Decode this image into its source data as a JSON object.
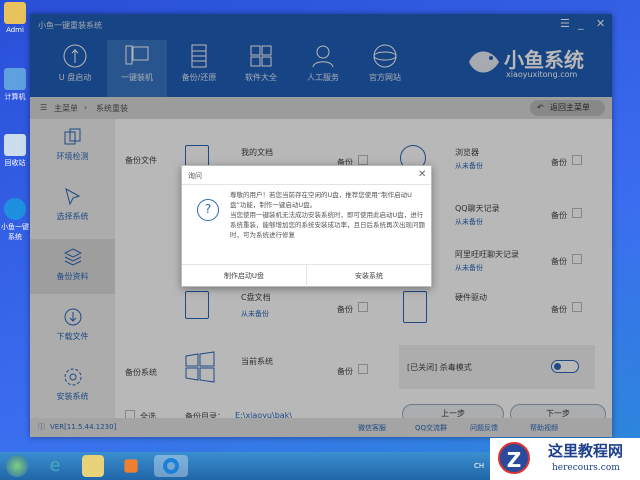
{
  "desktop": {
    "icons": [
      {
        "label": "Admi"
      },
      {
        "label": "计算机"
      },
      {
        "label": "回收站"
      },
      {
        "label": "小鱼一键系统"
      }
    ]
  },
  "window": {
    "title": "小鱼一键重装系统",
    "menu_icon": "menu-icon",
    "min_icon": "minimize-icon",
    "close_icon": "close-icon"
  },
  "nav": [
    {
      "label": "U 盘启动"
    },
    {
      "label": "一键装机",
      "active": true
    },
    {
      "label": "备份/还原"
    },
    {
      "label": "软件大全"
    },
    {
      "label": "人工服务"
    },
    {
      "label": "官方网站"
    }
  ],
  "logo": {
    "name": "小鱼系统",
    "url": "xiaoyuxitong.com"
  },
  "breadcrumb": {
    "home": "主菜单",
    "current": "系统重装",
    "back": "返回主菜单"
  },
  "sidebar": [
    {
      "label": "环境检测"
    },
    {
      "label": "选择系统"
    },
    {
      "label": "备份资料",
      "active": true
    },
    {
      "label": "下载文件"
    },
    {
      "label": "安装系统"
    }
  ],
  "backup": {
    "files_label": "备份文件",
    "system_label": "备份系统",
    "backup_word": "备份",
    "never": "从未备份",
    "items": [
      {
        "name": "我的文档"
      },
      {
        "name": "浏览器"
      },
      {
        "name": "QQ聊天记录"
      },
      {
        "name": "阿里旺旺聊天记录"
      },
      {
        "name": "C盘文档"
      },
      {
        "name": "硬件驱动"
      },
      {
        "name": "当前系统"
      }
    ],
    "antivirus": "[已关闭] 杀毒模式",
    "antivirus_on": false,
    "select_all": "全选",
    "dir_label": "备份目录：",
    "dir": "E:\\xiaoyu\\bak\\",
    "prev": "上一步",
    "next": "下一步"
  },
  "footer": {
    "version": "VER[11.5.44.1230]",
    "links": [
      "微信客服",
      "QQ交流群",
      "问题反馈",
      "帮助视频"
    ]
  },
  "dialog": {
    "title": "询问",
    "message1": "尊敬的用户！若您当前存在空闲的U盘，推荐您使用“制作启动U盘”功能，制作一键启动U盘。",
    "message2": "当您使用一键装机无法成功安装系统时，即可使用此启动U盘，进行系统重装，能够增加您的系统安装成功率，且日后系统再次出现问题时，可为系统进行修复",
    "btn_usb": "制作启动U盘",
    "btn_install": "安装系统"
  },
  "watermark": {
    "name": "这里教程网",
    "url": "herecours.com"
  },
  "tray": {
    "lang": "CH"
  }
}
